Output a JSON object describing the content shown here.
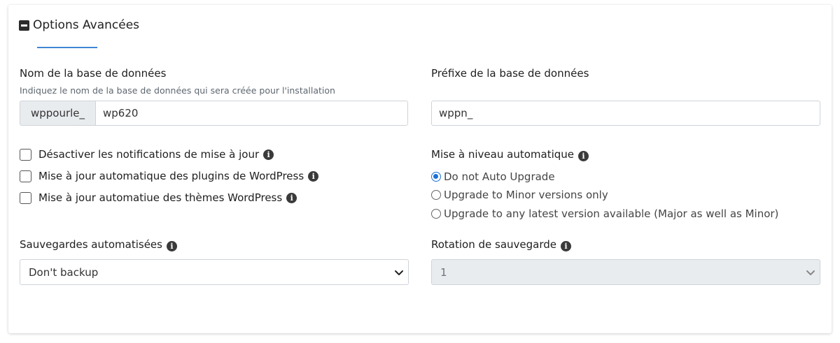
{
  "section": {
    "title": "Options Avancées"
  },
  "db_name": {
    "label": "Nom de la base de données",
    "hint": "Indiquez le nom de la base de données qui sera créée pour l'installation",
    "prefix_addon": "wppourle_",
    "value": "wp620"
  },
  "db_prefix": {
    "label": "Préfixe de la base de données",
    "value": "wppn_"
  },
  "checkboxes": [
    {
      "label": "Désactiver les notifications de mise à jour",
      "checked": false
    },
    {
      "label": "Mise à jour automatique des plugins de WordPress",
      "checked": false
    },
    {
      "label": "Mise à jour automatiue des thèmes WordPress",
      "checked": false
    }
  ],
  "auto_upgrade": {
    "label": "Mise à niveau automatique",
    "options": [
      {
        "label": "Do not Auto Upgrade",
        "selected": true
      },
      {
        "label": "Upgrade to Minor versions only",
        "selected": false
      },
      {
        "label": "Upgrade to any latest version available (Major as well as Minor)",
        "selected": false
      }
    ]
  },
  "backups": {
    "label": "Sauvegardes automatisées",
    "selected": "Don't backup"
  },
  "rotation": {
    "label": "Rotation de sauvegarde",
    "selected": "1",
    "disabled": true
  },
  "colors": {
    "accent": "#3d86d6",
    "radio_checked": "#1a6fd6",
    "addon_bg": "#e9ecef"
  },
  "icons": {
    "section_toggle": "minus-square-icon",
    "info": "info-circle-icon",
    "select_arrow": "chevron-down-icon"
  }
}
